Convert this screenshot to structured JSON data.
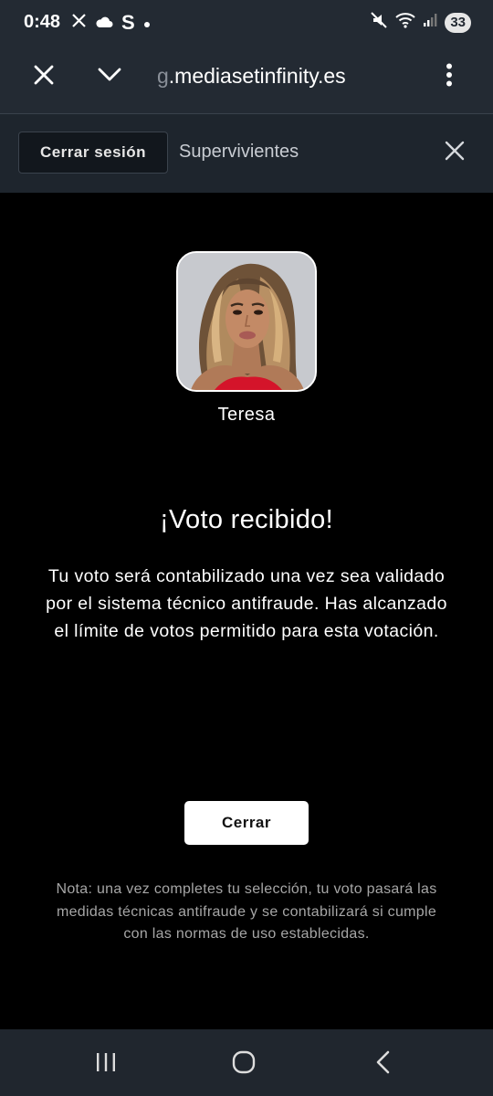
{
  "status_bar": {
    "time": "0:48",
    "left_icons": [
      "x-app-icon",
      "cloud-icon",
      "s-app-icon",
      "dot-icon"
    ],
    "s_glyph": "S",
    "right_icons": [
      "mute-icon",
      "wifi-icon",
      "signal-icon"
    ],
    "battery": "33"
  },
  "browser": {
    "url_prefix": "g",
    "url": ".mediasetinfinity.es",
    "icons": [
      "close-icon",
      "chevron-down-icon",
      "more-vertical-icon"
    ]
  },
  "header": {
    "logout_label": "Cerrar sesión",
    "title": "Supervivientes"
  },
  "main": {
    "contestant_name": "Teresa",
    "vote_title": "¡Voto recibido!",
    "vote_message": "Tu voto será contabilizado una vez sea validado por el sistema técnico antifraude. Has alcanzado el límite de votos permitido para esta votación.",
    "close_label": "Cerrar",
    "note": "Nota: una vez completes tu selección, tu voto pasará las medidas técnicas antifraude y se contabilizará si cumple con las normas de uso establecidas."
  },
  "nav_bar": {
    "icons": [
      "recent-apps-icon",
      "home-icon",
      "back-icon"
    ]
  },
  "colors": {
    "status_bar_bg": "#232a33",
    "page_bg": "#000000",
    "header_bg": "#1e252d",
    "note_text": "#a6a6a6",
    "contestant_top": "#d4142a"
  }
}
